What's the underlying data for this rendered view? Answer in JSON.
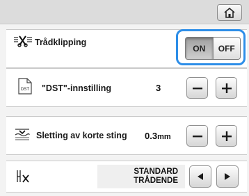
{
  "rows": {
    "thread_cut": {
      "label": "Trådklipping",
      "toggle": {
        "on_label": "ON",
        "off_label": "OFF",
        "selected": "ON"
      }
    },
    "dst": {
      "label": "\"DST\"-innstilling",
      "icon_text": "DST",
      "value": "3"
    },
    "short_stitch": {
      "label": "Sletting av korte sting",
      "value": "0.3",
      "unit": "mm"
    },
    "thread_end": {
      "line1": "STANDARD",
      "line2": "TRÅDENDE"
    }
  },
  "colors": {
    "highlight": "#2d8ee8"
  },
  "icons": [
    "home-icon",
    "thread-cut-icon",
    "dst-file-icon",
    "short-stitch-icon",
    "thread-end-icon",
    "minus-icon",
    "plus-icon",
    "left-arrow-icon",
    "right-arrow-icon"
  ]
}
